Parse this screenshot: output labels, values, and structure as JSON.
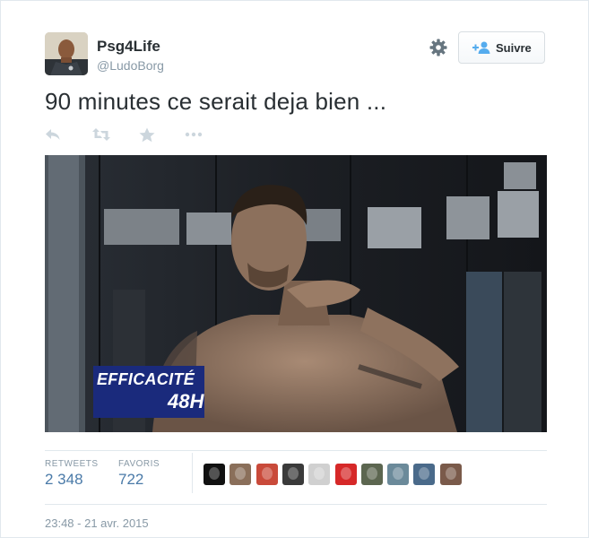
{
  "user": {
    "fullname": "Psg4Life",
    "username": "@LudoBorg",
    "avatar_icon": "player-avatar"
  },
  "header": {
    "settings_icon": "gear-icon",
    "follow_label": "Suivre",
    "follow_icon": "add-user-icon"
  },
  "tweet": {
    "text": "90 minutes ce serait deja bien ..."
  },
  "actions": [
    {
      "name": "reply-icon"
    },
    {
      "name": "retweet-icon"
    },
    {
      "name": "favorite-icon"
    },
    {
      "name": "more-icon"
    }
  ],
  "media": {
    "overlay_line1": "EFFICACITÉ",
    "overlay_line2": "48H"
  },
  "stats": {
    "retweets_label": "RETWEETS",
    "retweets_value": "2 348",
    "favorites_label": "FAVORIS",
    "favorites_value": "722"
  },
  "favoriters": [
    {
      "name": "favoriter-avatar-1",
      "color": "#111111"
    },
    {
      "name": "favoriter-avatar-2",
      "color": "#8a6f5a"
    },
    {
      "name": "favoriter-avatar-3",
      "color": "#c94a3a"
    },
    {
      "name": "favoriter-avatar-4",
      "color": "#3a3a3a"
    },
    {
      "name": "favoriter-avatar-5",
      "color": "#d0d0d0"
    },
    {
      "name": "favoriter-avatar-6",
      "color": "#d62828"
    },
    {
      "name": "favoriter-avatar-7",
      "color": "#5c6650"
    },
    {
      "name": "favoriter-avatar-8",
      "color": "#6b8a9a"
    },
    {
      "name": "favoriter-avatar-9",
      "color": "#4a6a8a"
    },
    {
      "name": "favoriter-avatar-10",
      "color": "#7a5a4a"
    }
  ],
  "timestamp": "23:48 - 21 avr. 2015",
  "colors": {
    "link": "#4a7aa8",
    "muted": "#8899a6",
    "text": "#292f33",
    "overlay": "#1a2a7c"
  }
}
